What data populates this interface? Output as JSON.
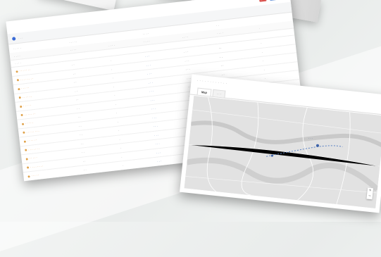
{
  "background": {
    "accent": "#e9eceb"
  },
  "table_card": {
    "badges": [
      "■ ■",
      "■ ■",
      "▾"
    ],
    "breadcrumb": "· · ·",
    "col_groups": [
      "· · · · ·",
      "· · · · ·",
      "· · · ·",
      "· ·"
    ],
    "sub_heads": [
      "· · · ·",
      "· · · ·",
      "· · · ·",
      "· · · ·",
      "· · · ·",
      "· · · ·",
      "·"
    ],
    "section": "· · · ·",
    "rows": [
      [
        "· · · · · · ·",
        "· ·",
        "·",
        "· · ·",
        "· · ·",
        "· ·",
        "·"
      ],
      [
        "· · · · · · · ·",
        "· ·",
        "·",
        "· · ·",
        "· · ·",
        "· ·",
        "·"
      ],
      [
        "· · · · ·",
        "· ·",
        "·",
        "· · ·",
        "· · ·",
        "· ·",
        "·"
      ],
      [
        "· · · · · ·",
        "· ·",
        "·",
        "· · ·",
        "· · ·",
        "· ·",
        "·"
      ],
      [
        "· · · · ·",
        "· ·",
        "·",
        "· · ·",
        "· · ·",
        "· ·",
        "·"
      ],
      [
        "· · · · · · ·",
        "· ·",
        "·",
        "· · ·",
        "· · ·",
        "· ·",
        "·"
      ],
      [
        "· · · · ·",
        "· ·",
        "·",
        "· · ·",
        "· · ·",
        "· ·",
        "·"
      ],
      [
        "· · · · · · · ·",
        "· ·",
        "·",
        "· · ·",
        "· · ·",
        "· ·",
        "·"
      ],
      [
        "· · · · · ·",
        "· ·",
        "·",
        "· · ·",
        "· · ·",
        "· ·",
        "·"
      ],
      [
        "· · · · · · ·",
        "· ·",
        "·",
        "· · ·",
        "· · ·",
        "· ·",
        "·"
      ],
      [
        "· · · · ·",
        "· ·",
        "·",
        "· · ·",
        "· · ·",
        "· ·",
        "·"
      ],
      [
        "· · · · · · · ·",
        "· ·",
        "·",
        "· · ·",
        "· · ·",
        "· ·",
        "·"
      ],
      [
        "· · · · ·",
        "· ·",
        "·",
        "· · ·",
        "· · ·",
        "· ·",
        "·"
      ],
      [
        "· · · · · ·",
        "· ·",
        "·",
        "· · ·",
        "· · ·",
        "· ·",
        "·"
      ]
    ]
  },
  "map_card": {
    "title": "· · · · · · · · · · · ·",
    "tabs": [
      "Map",
      "· · ·"
    ],
    "place_label": "· · ·",
    "zoom_in": "+",
    "zoom_out": "−"
  }
}
